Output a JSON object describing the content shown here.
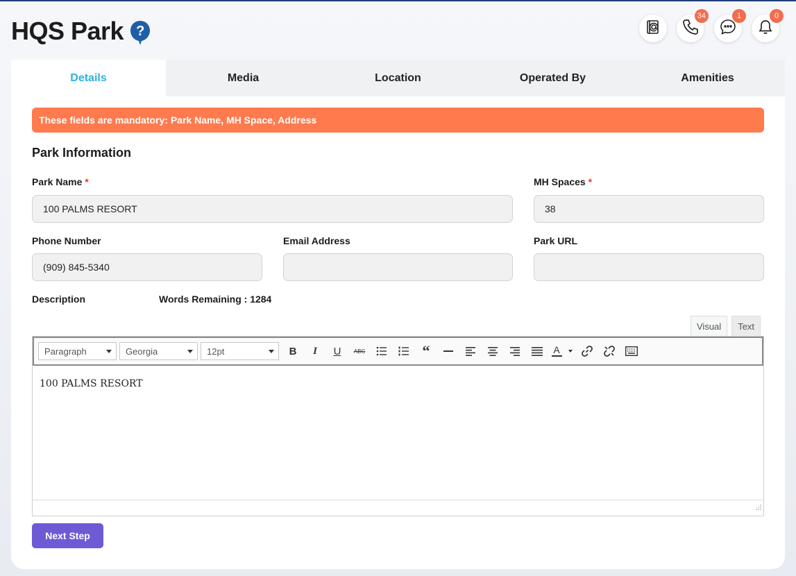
{
  "app": {
    "title": "HQS Park"
  },
  "header": {
    "icons": [
      {
        "name": "contacts-book-icon",
        "badge": null
      },
      {
        "name": "phone-icon",
        "badge": "34"
      },
      {
        "name": "chat-icon",
        "badge": "1"
      },
      {
        "name": "bell-icon",
        "badge": "0"
      }
    ]
  },
  "tabs": [
    {
      "label": "Details",
      "active": true
    },
    {
      "label": "Media",
      "active": false
    },
    {
      "label": "Location",
      "active": false
    },
    {
      "label": "Operated By",
      "active": false
    },
    {
      "label": "Amenities",
      "active": false
    }
  ],
  "alert": {
    "text": "These fields are mandatory: Park Name, MH Space, Address",
    "color": "#ff7a4d"
  },
  "form": {
    "section_title": "Park Information",
    "park_name": {
      "label": "Park Name",
      "required": "*",
      "value": "100 PALMS RESORT"
    },
    "mh_spaces": {
      "label": "MH Spaces",
      "required": "*",
      "value": "38"
    },
    "phone": {
      "label": "Phone Number",
      "value": "(909) 845-5340"
    },
    "email": {
      "label": "Email Address",
      "value": ""
    },
    "park_url": {
      "label": "Park URL",
      "value": ""
    },
    "description": {
      "label": "Description",
      "words_remaining": "Words Remaining : 1284"
    }
  },
  "editor": {
    "tabs": [
      "Visual",
      "Text"
    ],
    "format": "Paragraph",
    "font": "Georgia",
    "size": "12pt",
    "content": "100 PALMS RESORT"
  },
  "actions": {
    "next_label": "Next Step",
    "accent": "#6f5ad6"
  }
}
